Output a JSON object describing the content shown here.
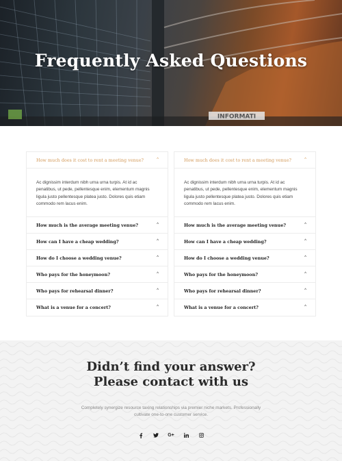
{
  "hero": {
    "title": "Frequently Asked Questions",
    "sign_text": "INFORMATI"
  },
  "faq": {
    "columns": [
      {
        "open_question": "How much does it cost to rent a meeting venue?",
        "answer": "Ac dignissim interdum nibh urna urna turpis. At id ac penatibus, ut pede, pellentesque enim, elementum magnis ligula justo pellentesque platea justo. Dolores quis etiam commodo rem lacus enim.",
        "questions": [
          "How much is the average meeting venue?",
          "How can I have a cheap wedding?",
          "How do I choose a wedding venue?",
          "Who pays for the honeymoon?",
          "Who pays for rehearsal dinner?",
          "What is a venue for a concert?"
        ]
      },
      {
        "open_question": "How much does it cost to rent a meeting venue?",
        "answer": "Ac dignissim interdum nibh urna urna turpis. At id ac penatibus, ut pede, pellentesque enim, elementum magnis ligula justo pellentesque platea justo. Dolores quis etiam commodo rem lacus enim.",
        "questions": [
          "How much is the average meeting venue?",
          "How can I have a cheap wedding?",
          "How do I choose a wedding venue?",
          "Who pays for the honeymoon?",
          "Who pays for rehearsal dinner?",
          "What is a venue for a concert?"
        ]
      }
    ],
    "chevron_glyph": "^",
    "accent_color": "#d39a5a"
  },
  "contact": {
    "heading_line1": "Didn’t find your answer?",
    "heading_line2": "Please contact with us",
    "description": "Completely synergize resource taxing relationships via premier niche markets. Professionally cultivate one-to-one customer service.",
    "social": [
      "facebook-icon",
      "twitter-icon",
      "google-plus-icon",
      "linkedin-icon",
      "instagram-icon"
    ],
    "google_plus_glyph": "G+"
  }
}
